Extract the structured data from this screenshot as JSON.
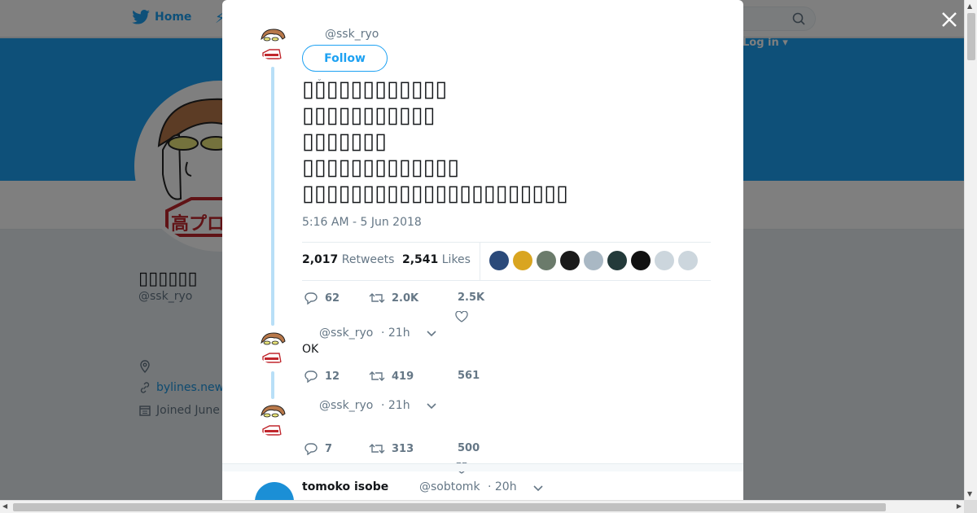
{
  "topbar": {
    "home_label": "Home",
    "login_label": "Log in ▾"
  },
  "profile": {
    "name": "▯▯▯▯▯▯",
    "handle": "@ssk_ryo",
    "link_text": "bylines.new",
    "joined_text": "Joined June"
  },
  "modal": {
    "main_tweet": {
      "handle": "@ssk_ryo",
      "follow_label": "Follow",
      "text": "▯▯▯▯▯▯▯▯▯▯▯▯\n▯▯▯▯▯▯▯▯▯▯▯\n▯▯▯▯▯▯▯\n▯▯▯▯▯▯▯▯▯▯▯▯▯\n▯▯▯▯▯▯▯▯▯▯▯▯▯▯▯▯▯▯▯▯▯▯",
      "timestamp": "5:16 AM - 5 Jun 2018",
      "retweets_count": "2,017",
      "retweets_label": "Retweets",
      "likes_count": "2,541",
      "likes_label": "Likes",
      "replies": "62",
      "retweets_short": "2.0K",
      "likes_short": "2.5K"
    },
    "replies": [
      {
        "handle": "@ssk_ryo",
        "time": "· 21h",
        "text": "OK",
        "replies": "12",
        "retweets": "419",
        "likes": "561"
      },
      {
        "handle": "@ssk_ryo",
        "time": "· 21h",
        "text": "",
        "replies": "7",
        "retweets": "313",
        "likes": "500"
      }
    ],
    "next_tweet": {
      "name": "tomoko isobe",
      "handle": "@sobtomk",
      "time": "· 20h"
    }
  },
  "colors": {
    "accent": "#1da1f2",
    "liker_colors": [
      "#2b4a7a",
      "#d9a520",
      "#6b7b6b",
      "#1a1a1a",
      "#a9b8c4",
      "#233a3a",
      "#111111",
      "#ccd6dd",
      "#ccd6dd"
    ]
  },
  "icons": [
    "twitter-bird-icon",
    "bolt-icon",
    "search-icon",
    "close-icon",
    "location-icon",
    "link-icon",
    "calendar-icon",
    "reply-icon",
    "retweet-icon",
    "heart-icon",
    "chevron-down-icon"
  ]
}
